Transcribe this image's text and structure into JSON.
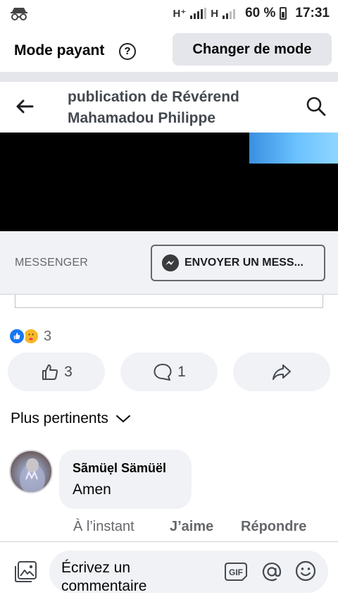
{
  "status_bar": {
    "network_1": "H⁺",
    "network_2": "H",
    "battery_percent": "60 %",
    "time": "17:31",
    "left_icon": "incognito-icon"
  },
  "mode_bar": {
    "label": "Mode payant",
    "help_icon_glyph": "?",
    "change_button": "Changer de mode"
  },
  "header": {
    "title": "publication de Révérend Mahamadou Philippe",
    "back_icon": "back-arrow-icon",
    "search_icon": "search-icon"
  },
  "messenger": {
    "label": "MESSENGER",
    "button": "ENVOYER UN MESS..."
  },
  "reactions": {
    "icons": [
      "like-reaction-icon",
      "care-reaction-icon"
    ],
    "count": "3"
  },
  "actions": {
    "like_count": "3",
    "comment_count": "1",
    "share_icon": "share-icon"
  },
  "sort": {
    "label": "Plus pertinents"
  },
  "comment": {
    "author": "Sãmüẹl Sämüël",
    "text": "Amen",
    "time": "À l’instant",
    "like_label": "J’aime",
    "reply_label": "Répondre"
  },
  "composer": {
    "placeholder": "Écrivez un commentaire",
    "gif_label": "GIF",
    "icons": [
      "photo-icon",
      "gif-icon",
      "at-mention-icon",
      "emoji-icon"
    ]
  },
  "colors": {
    "facebook_blue": "#1877f2",
    "grey_surface": "#f0f2f5",
    "secondary_text": "#65676b"
  }
}
